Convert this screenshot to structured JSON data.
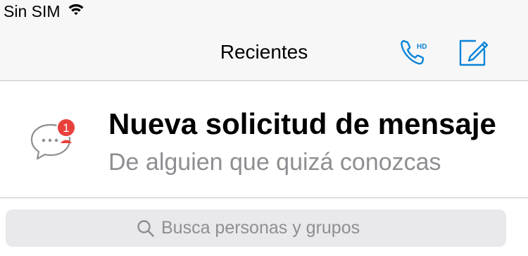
{
  "status_bar": {
    "carrier": "Sin SIM",
    "wifi_icon": "wifi-icon"
  },
  "nav": {
    "title": "Recientes",
    "call_icon": "hd-phone-icon",
    "call_badge": "HD",
    "compose_icon": "compose-icon"
  },
  "message_request": {
    "title": "Nueva solicitud de mensaje",
    "subtitle": "De alguien que quizá conozcas",
    "badge_count": "1",
    "icon": "chat-bubble-icon"
  },
  "search": {
    "placeholder": "Busca personas y grupos",
    "icon": "search-icon"
  },
  "colors": {
    "accent": "#0a84d8",
    "badge": "#e8413c",
    "secondary_text": "#8e8e93",
    "bar_background": "#f7f7f7",
    "search_background": "#e9e9eb",
    "separator": "#c8c8cc"
  }
}
